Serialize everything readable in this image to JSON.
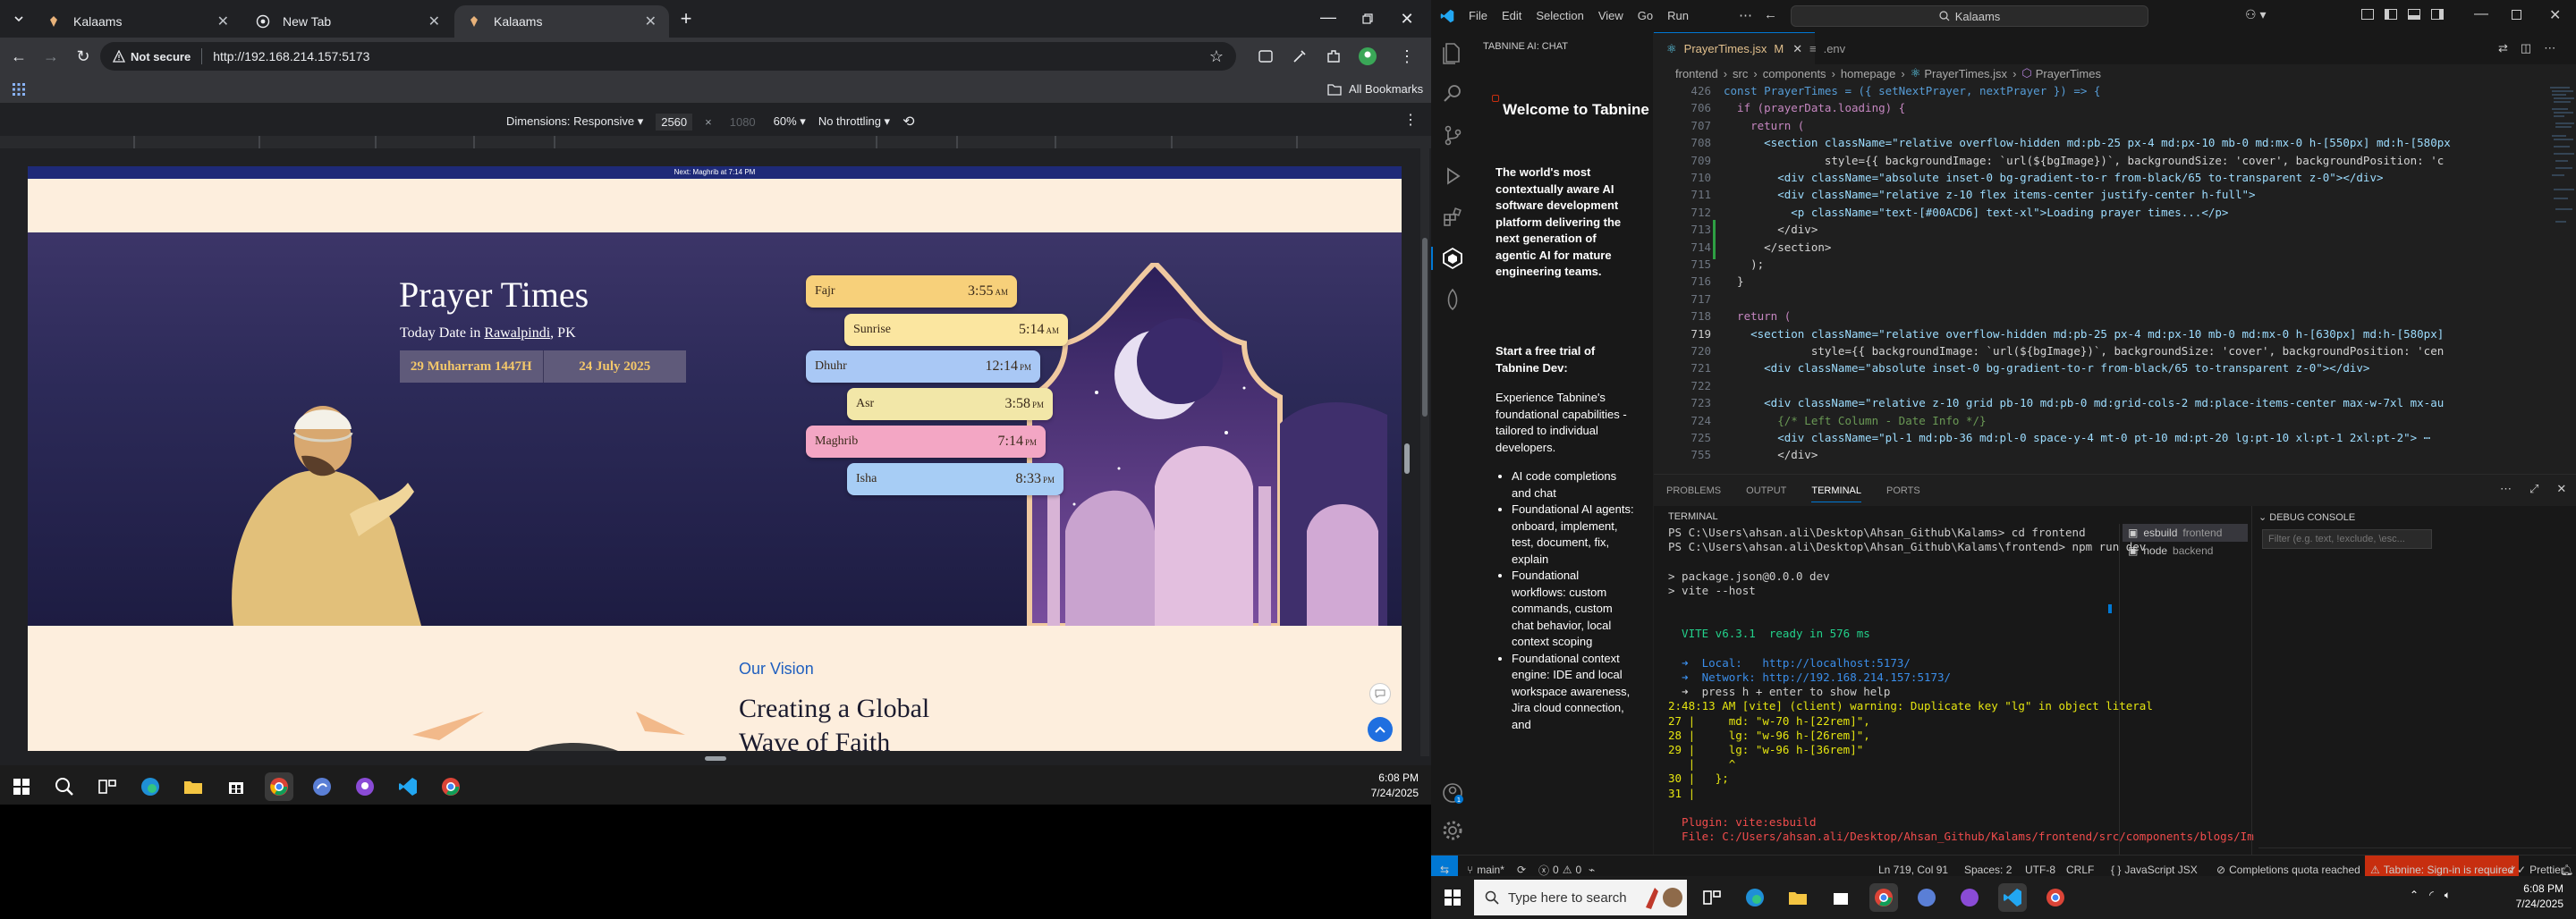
{
  "chrome": {
    "tabs": [
      {
        "title": "Kalaams",
        "active": false
      },
      {
        "title": "New Tab",
        "active": false
      },
      {
        "title": "Kalaams",
        "active": true
      }
    ],
    "not_secure": "Not secure",
    "url": "http://192.168.214.157:5173",
    "all_bookmarks": "All Bookmarks",
    "devtools": {
      "dimensions_label": "Dimensions: Responsive",
      "width": "2560",
      "times": "×",
      "height": "1080",
      "zoom": "60%",
      "throttle": "No throttling"
    },
    "site": {
      "announcement": "Next: Maghrib at 7:14 PM",
      "hero_title": "Prayer Times",
      "today_prefix": "Today Date in ",
      "city": "Rawalpindi",
      "country_suffix": ", PK",
      "hijri_date": "29 Muharram 1447H",
      "gregorian_date": "24 July 2025",
      "prayers": [
        {
          "name": "Fajr",
          "time": "3:55",
          "period": "AM",
          "color": "#f7d07a"
        },
        {
          "name": "Sunrise",
          "time": "5:14",
          "period": "AM",
          "color": "#fbe6a0"
        },
        {
          "name": "Dhuhr",
          "time": "12:14",
          "period": "PM",
          "color": "#a9c8f5"
        },
        {
          "name": "Asr",
          "time": "3:58",
          "period": "PM",
          "color": "#f2e7a8"
        },
        {
          "name": "Maghrib",
          "time": "7:14",
          "period": "PM",
          "color": "#f3a6c4"
        },
        {
          "name": "Isha",
          "time": "8:33",
          "period": "PM",
          "color": "#a7cdf5"
        }
      ],
      "vision_kicker": "Our Vision",
      "vision_title_1": "Creating a Global",
      "vision_title_2": "Wave of Faith"
    }
  },
  "left_taskbar": {
    "time": "6:08 PM",
    "date": "7/24/2025"
  },
  "vscode": {
    "menu": [
      "File",
      "Edit",
      "Selection",
      "View",
      "Go",
      "Run"
    ],
    "search": "Kalaams",
    "chat": {
      "panel_title": "TABNINE AI: CHAT",
      "welcome": "Welcome to Tabnine",
      "intro": "The world's most contextually aware AI software development platform delivering the next generation of agentic AI for mature engineering teams.",
      "trial": "Start a free trial of Tabnine Dev:",
      "experience": "Experience Tabnine's foundational capabilities - tailored to individual developers.",
      "bullets": [
        "AI code completions and chat",
        "Foundational AI agents: onboard, implement, test, document, fix, explain",
        "Foundational workflows: custom commands, custom chat behavior, local context scoping",
        "Foundational context engine: IDE and local workspace awareness, Jira cloud connection, and"
      ]
    },
    "editor_tabs": [
      {
        "name": "PrayerTimes.jsx",
        "badge": "M",
        "active": true
      },
      {
        "name": ".env",
        "badge": "",
        "active": false
      }
    ],
    "breadcrumb": [
      "frontend",
      "src",
      "components",
      "homepage",
      "PrayerTimes.jsx",
      "PrayerTimes"
    ],
    "code_lines": [
      {
        "n": "426",
        "t": "const PrayerTimes = ({ setNextPrayer, nextPrayer }) => {"
      },
      {
        "n": "706",
        "t": "  if (prayerData.loading) {"
      },
      {
        "n": "707",
        "t": "    return ("
      },
      {
        "n": "708",
        "t": "      <section className=\"relative overflow-hidden md:pb-25 px-4 md:px-10 mb-0 md:mx-0 h-[550px] md:h-[580px"
      },
      {
        "n": "709",
        "t": "               style={{ backgroundImage: `url(${bgImage})`, backgroundSize: 'cover', backgroundPosition: 'c"
      },
      {
        "n": "710",
        "t": "        <div className=\"absolute inset-0 bg-gradient-to-r from-black/65 to-transparent z-0\"></div>"
      },
      {
        "n": "711",
        "t": "        <div className=\"relative z-10 flex items-center justify-center h-full\">"
      },
      {
        "n": "712",
        "t": "          <p className=\"text-[#00ACD6] text-xl\">Loading prayer times...</p>"
      },
      {
        "n": "713",
        "t": "        </div>"
      },
      {
        "n": "714",
        "t": "      </section>"
      },
      {
        "n": "715",
        "t": "    );"
      },
      {
        "n": "716",
        "t": "  }"
      },
      {
        "n": "717",
        "t": ""
      },
      {
        "n": "718",
        "t": "  return ("
      },
      {
        "n": "719",
        "t": "    <section className=\"relative overflow-hidden md:pb-25 px-4 md:px-10 mb-0 md:mx-0 h-[630px] md:h-[580px]"
      },
      {
        "n": "720",
        "t": "             style={{ backgroundImage: `url(${bgImage})`, backgroundSize: 'cover', backgroundPosition: 'cen"
      },
      {
        "n": "721",
        "t": "      <div className=\"absolute inset-0 bg-gradient-to-r from-black/65 to-transparent z-0\"></div>"
      },
      {
        "n": "722",
        "t": ""
      },
      {
        "n": "723",
        "t": "      <div className=\"relative z-10 grid pb-10 md:pb-0 md:grid-cols-2 md:place-items-center max-w-7xl mx-au"
      },
      {
        "n": "724",
        "t": "        {/* Left Column - Date Info */}"
      },
      {
        "n": "725",
        "t": "        <div className=\"pl-1 md:pb-36 md:pl-0 space-y-4 mt-0 pt-10 md:pt-20 lg:pt-10 xl:pt-1 2xl:pt-2\"> ⋯"
      },
      {
        "n": "755",
        "t": "        </div>"
      }
    ],
    "panel_tabs": [
      "PROBLEMS",
      "OUTPUT",
      "TERMINAL",
      "PORTS"
    ],
    "terminal_label": "TERMINAL",
    "debug_label": "DEBUG CONSOLE",
    "filter_placeholder": "Filter (e.g. text, !exclude, \\esc...",
    "terminal_lines": [
      "PS C:\\Users\\ahsan.ali\\Desktop\\Ahsan_Github\\Kalams> cd frontend",
      "PS C:\\Users\\ahsan.ali\\Desktop\\Ahsan_Github\\Kalams\\frontend> npm run dev",
      "",
      "> package.json@0.0.0 dev",
      "> vite --host",
      "",
      "",
      "  VITE v6.3.1  ready in 576 ms",
      "",
      "  ➜  Local:   http://localhost:5173/",
      "  ➜  Network: http://192.168.214.157:5173/",
      "  ➜  press h + enter to show help",
      "2:48:13 AM [vite] (client) warning: Duplicate key \"lg\" in object literal",
      "27 |     md: \"w-70 h-[22rem]\",",
      "28 |     lg: \"w-96 h-[26rem]\",",
      "29 |     lg: \"w-96 h-[36rem]\"",
      "   |     ^",
      "30 |   };",
      "31 |",
      "",
      "  Plugin: vite:esbuild",
      "  File: C:/Users/ahsan.ali/Desktop/Ahsan_Github/Kalams/frontend/src/components/blogs/Im"
    ],
    "terminals": [
      {
        "name": "esbuild",
        "sub": "frontend"
      },
      {
        "name": "node",
        "sub": "backend"
      }
    ],
    "status": {
      "branch": "main*",
      "errors": "0",
      "warnings": "0",
      "position": "Ln 719, Col 91",
      "spaces": "Spaces: 2",
      "encoding": "UTF-8",
      "eol": "CRLF",
      "language": "JavaScript JSX",
      "quota": "Completions quota reached",
      "tabnine": "Tabnine: Sign-in is required",
      "prettier": "Prettier"
    }
  },
  "right_taskbar": {
    "search_placeholder": "Type here to search",
    "time": "6:08 PM",
    "date": "7/24/2025"
  },
  "colors": {
    "vscode_accent": "#0078d4",
    "tabnine_error": "#c72e0f",
    "hero_bg": "#2c2a58",
    "page_bg": "#fdeedd",
    "vision_blue": "#1f5fbf"
  }
}
